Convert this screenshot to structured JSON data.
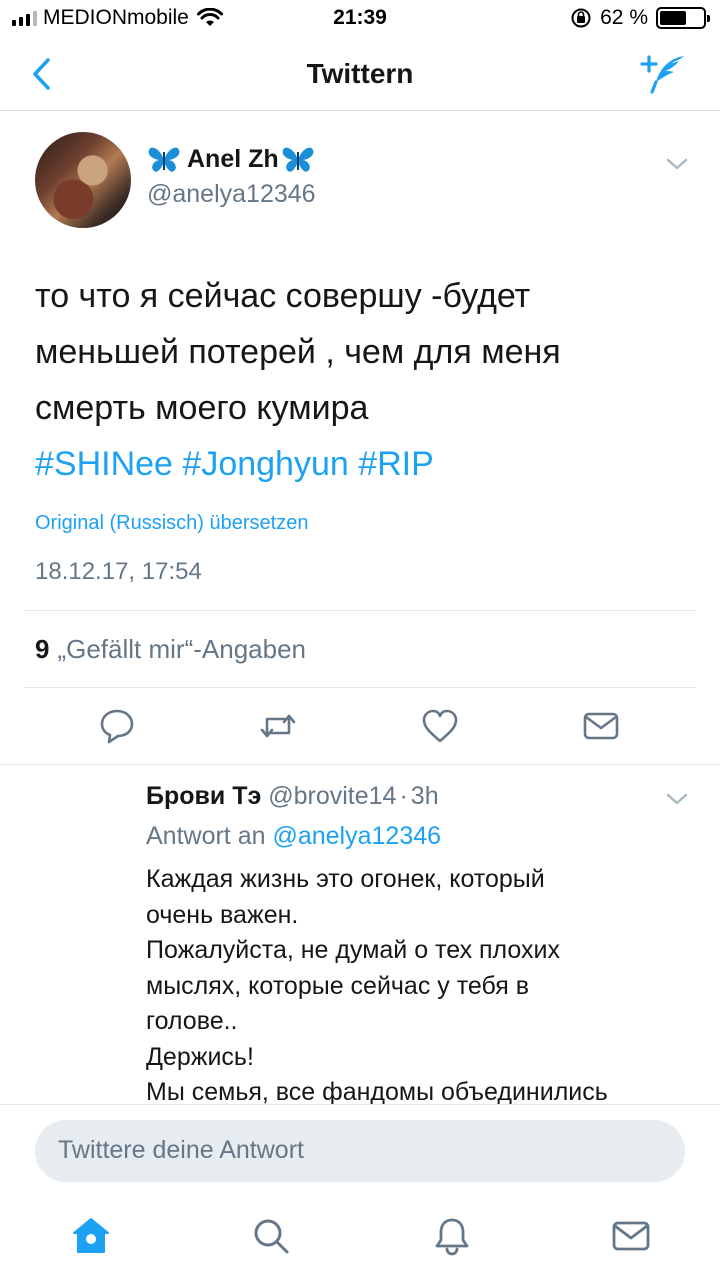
{
  "status_bar": {
    "carrier": "MEDIONmobile",
    "time": "21:39",
    "battery_text": "62 %",
    "battery_level": 0.62
  },
  "nav": {
    "title": "Twittern",
    "back_icon": "chevron-left-icon",
    "compose_icon": "compose-tweet-icon"
  },
  "tweet": {
    "author_name": "Anel Zh",
    "author_handle": "@anelya12346",
    "text_lines": [
      "то что я сейчас совершу -будет",
      "меньшей потерей , чем для меня",
      "смерть моего кумира"
    ],
    "hashtags": "#SHINee #Jonghyun #RIP",
    "translate_label": "Original (Russisch) übersetzen",
    "timestamp": "18.12.17, 17:54",
    "likes_count": "9",
    "likes_label": "„Gefällt mir“-Angaben",
    "actions": [
      "reply-icon",
      "retweet-icon",
      "like-icon",
      "direct-message-icon"
    ]
  },
  "reply": {
    "name": "Брови Тэ",
    "handle": "@brovite14",
    "separator": "·",
    "time": "3h",
    "reply_to_prefix": "Antwort an",
    "reply_to_handle": "@anelya12346",
    "text_lines": [
      "Каждая жизнь это огонек, который",
      "очень важен.",
      "Пожалуйста, не думай о тех плохих",
      "мыслях, которые сейчас у тебя в",
      "голове..",
      "Держись!",
      "Мы семья, все фандомы объединились"
    ]
  },
  "composer": {
    "placeholder": "Twittere deine Antwort"
  },
  "tab_bar": [
    "home-icon",
    "search-icon",
    "notifications-icon",
    "messages-icon"
  ],
  "colors": {
    "accent": "#1da1f2",
    "secondary_text": "#657786",
    "primary_text": "#14171a",
    "divider": "#e1e8ed"
  }
}
